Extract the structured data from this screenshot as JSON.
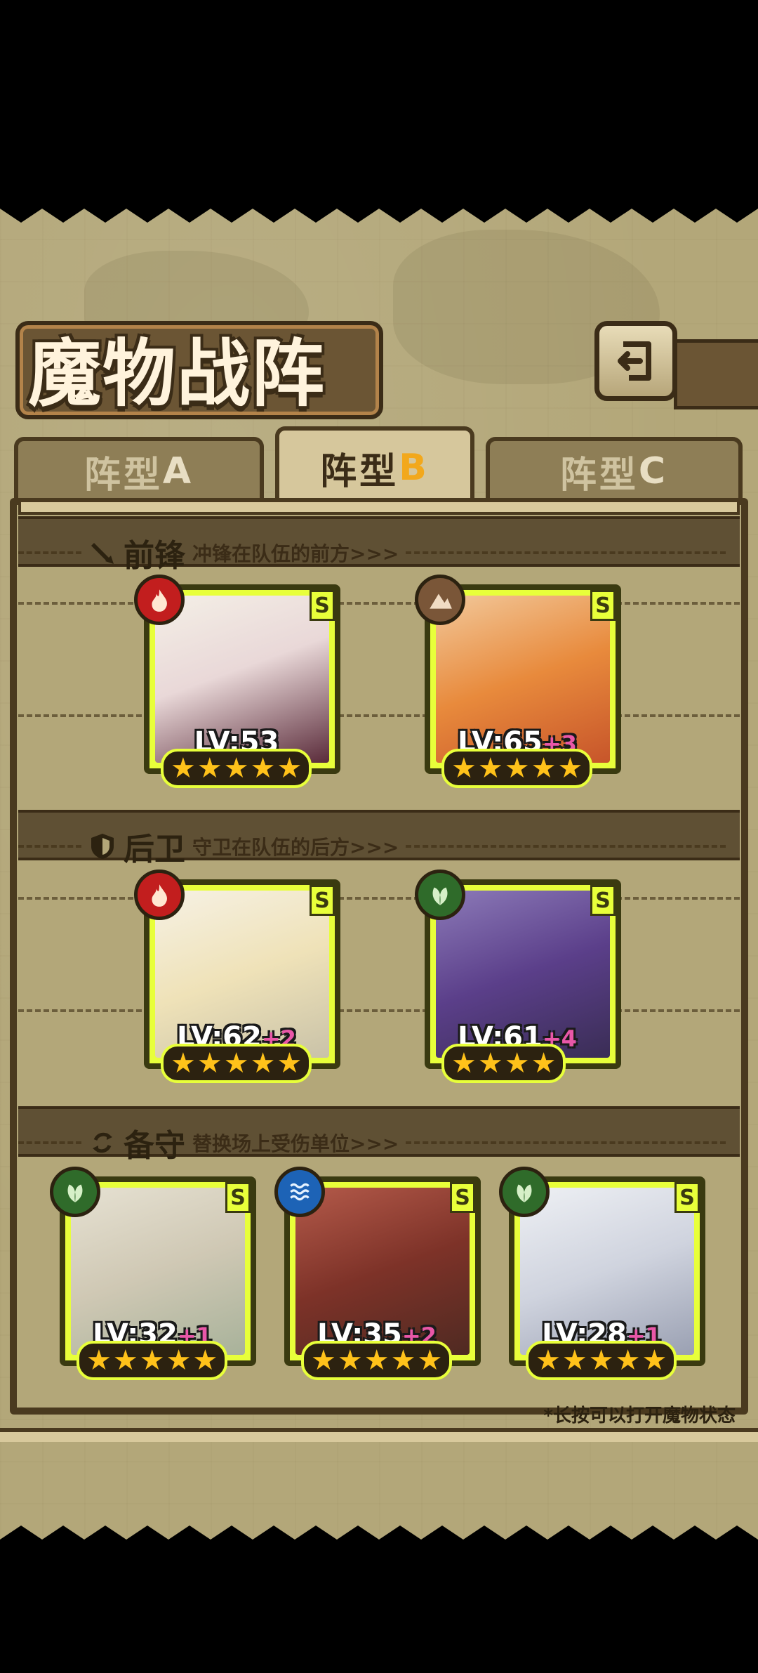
{
  "title": "魔物战阵",
  "tabs": [
    {
      "prefix": "阵型",
      "letter": "A",
      "active": false
    },
    {
      "prefix": "阵型",
      "letter": "B",
      "active": true
    },
    {
      "prefix": "阵型",
      "letter": "C",
      "active": false
    }
  ],
  "sections": {
    "front": {
      "title": "前锋",
      "subtitle": "冲锋在队伍的前方>>>",
      "icon": "sword-icon"
    },
    "rear": {
      "title": "后卫",
      "subtitle": "守卫在队伍的后方>>>",
      "icon": "shield-icon"
    },
    "reserve": {
      "title": "备守",
      "subtitle": "替换场上受伤单位>>>",
      "icon": "swap-icon"
    }
  },
  "units": {
    "front": [
      {
        "element": "fire",
        "rank": "S",
        "level_text": "LV:53",
        "plus": "",
        "stars": 5
      },
      {
        "element": "earth",
        "rank": "S",
        "level_text": "LV:65",
        "plus": "+3",
        "stars": 5
      }
    ],
    "rear": [
      {
        "element": "fire",
        "rank": "S",
        "level_text": "LV:62",
        "plus": "+2",
        "stars": 5
      },
      {
        "element": "nature",
        "rank": "S",
        "level_text": "LV:61",
        "plus": "+4",
        "stars": 4
      }
    ],
    "reserve": [
      {
        "element": "nature",
        "rank": "S",
        "level_text": "LV:32",
        "plus": "+1",
        "stars": 5
      },
      {
        "element": "water",
        "rank": "S",
        "level_text": "LV:35",
        "plus": "+2",
        "stars": 5
      },
      {
        "element": "nature",
        "rank": "S",
        "level_text": "LV:28",
        "plus": "+1",
        "stars": 5
      }
    ]
  },
  "footer_note": "*长按可以打开魔物状态",
  "colors": {
    "card_border": "#e8ff3a",
    "plus": "#e957a8",
    "star": "#ffc21a",
    "accent_tab": "#f2a81c"
  }
}
